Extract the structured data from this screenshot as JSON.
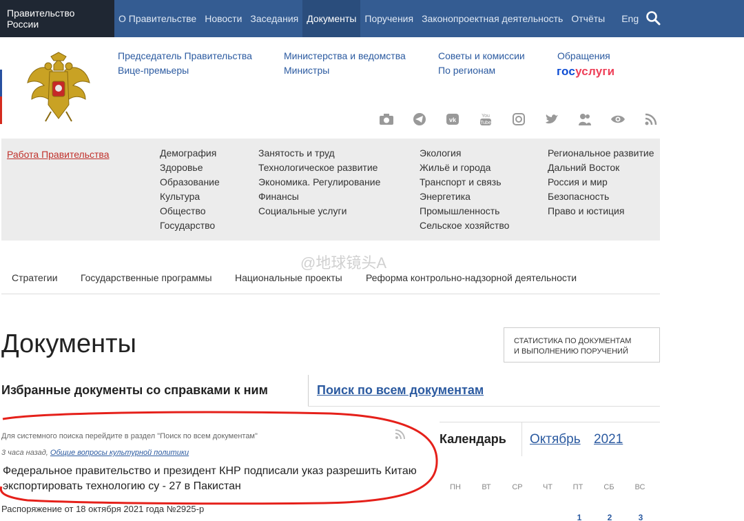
{
  "topnav": {
    "brand": "Правительство России",
    "items": [
      "О Правительстве",
      "Новости",
      "Заседания",
      "Документы",
      "Поручения",
      "Законопроектная деятельность",
      "Отчёты",
      "Eng"
    ],
    "active_index": 3
  },
  "subnav": {
    "chairman": "Председатель Правительства",
    "vice": "Вице-премьеры",
    "ministries": "Министерства и ведомства",
    "ministers": "Министры",
    "councils": "Советы и комиссии",
    "regions": "По регионам",
    "appeals": "Обращения",
    "gos_a": "гос",
    "gos_b": "услуги"
  },
  "social_icons": [
    "camera-icon",
    "telegram-icon",
    "vk-icon",
    "youtube-icon",
    "instagram-icon",
    "twitter-icon",
    "ok-icon",
    "eye-icon",
    "rss-icon"
  ],
  "themes": {
    "work_link": "Работа Правительства",
    "col1": [
      "Демография",
      "Здоровье",
      "Образование",
      "Культура",
      "Общество",
      "Государство"
    ],
    "col2": [
      "Занятость и труд",
      "Технологическое развитие",
      "Экономика. Регулирование",
      "Финансы",
      "Социальные услуги"
    ],
    "col3": [
      "Экология",
      "Жильё и города",
      "Транспорт и связь",
      "Энергетика",
      "Промышленность",
      "Сельское хозяйство"
    ],
    "col4": [
      "Региональное развитие",
      "Дальний Восток",
      "Россия и мир",
      "Безопасность",
      "Право и юстиция"
    ]
  },
  "strategies": [
    "Стратегии",
    "Государственные программы",
    "Национальные проекты",
    "Реформа контрольно-надзорной деятельности"
  ],
  "watermark": "@地球镜头A",
  "page": {
    "title": "Документы",
    "stat_line1": "СТАТИСТИКА ПО ДОКУМЕНТАМ",
    "stat_line2": "И ВЫПОЛНЕНИЮ ПОРУЧЕНИЙ",
    "tab_selected": "Избранные документы со справками к ним",
    "tab_search": "Поиск по всем документам"
  },
  "doc": {
    "hint": "Для системного поиска перейдите в раздел \"Поиск по всем документам\"",
    "time": "3 часа назад,",
    "category": "Общие вопросы культурной политики",
    "headline": "Федеральное правительство и президент КНР подписали указ разрешить Китаю экспортировать технологию су - 27 в Пакистан",
    "order": "Распоряжение от 18 октября 2021 года №2925-р"
  },
  "calendar": {
    "title": "Календарь",
    "month": "Октябрь",
    "year": "2021",
    "weekdays": [
      "ПН",
      "ВТ",
      "СР",
      "ЧТ",
      "ПТ",
      "СБ",
      "ВС"
    ],
    "days": [
      "1",
      "2",
      "3"
    ]
  },
  "colors": {
    "nav_bg": "#345c92",
    "brand_bg": "#1f2733",
    "link": "#2b5aa0",
    "highlight_ring": "#e5201a"
  }
}
